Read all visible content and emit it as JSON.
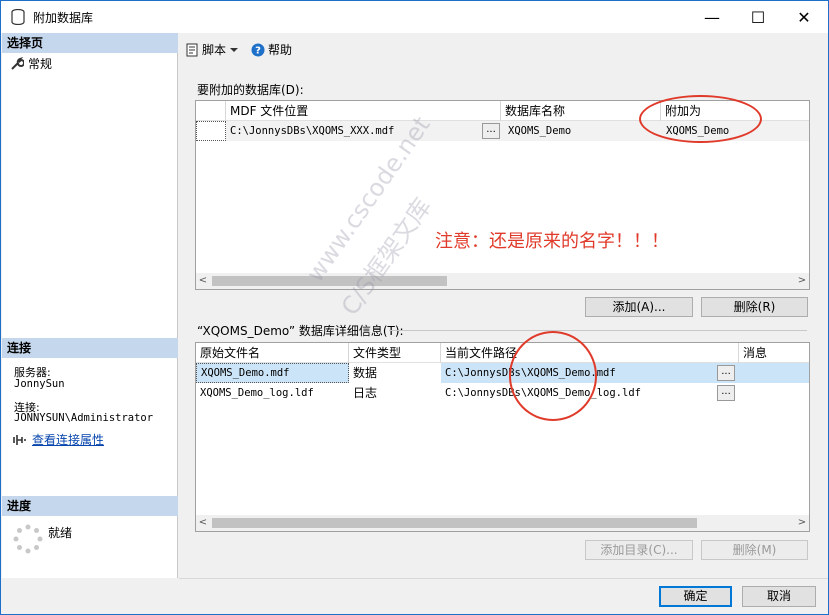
{
  "window": {
    "title": "附加数据库",
    "controls": {
      "minimize": "—",
      "maximize": "☐",
      "close": "✕"
    }
  },
  "left": {
    "select_page_header": "选择页",
    "pages": [
      {
        "label": "常规",
        "icon": "wrench-icon"
      }
    ],
    "connection_header": "连接",
    "server_label": "服务器:",
    "server_value": "JonnySun",
    "connection_label": "连接:",
    "connection_value": "JONNYSUN\\Administrator",
    "view_connection_link": "查看连接属性",
    "progress_header": "进度",
    "progress_status": "就绪"
  },
  "toolbar": {
    "script_label": "脚本",
    "help_label": "帮助"
  },
  "attach_section": {
    "label": "要附加的数据库(D):",
    "columns": [
      "MDF 文件位置",
      "数据库名称",
      "附加为"
    ],
    "rows": [
      {
        "mdf_path": "C:\\JonnysDBs\\XQOMS_XXX.mdf",
        "db_name": "XQOMS_Demo",
        "attach_as": "XQOMS_Demo"
      }
    ],
    "add_button": "添加(A)...",
    "remove_button": "删除(R)"
  },
  "annotation": {
    "note": "注意：还是原来的名字！！！"
  },
  "details_section": {
    "label": "“XQOMS_Demo” 数据库详细信息(T):",
    "columns": [
      "原始文件名",
      "文件类型",
      "当前文件路径",
      "消息"
    ],
    "rows": [
      {
        "file": "XQOMS_Demo.mdf",
        "type": "数据",
        "path": "C:\\JonnysDBs\\XQOMS_Demo.mdf",
        "message": ""
      },
      {
        "file": "XQOMS_Demo_log.ldf",
        "type": "日志",
        "path": "C:\\JonnysDBs\\XQOMS_Demo_log.ldf",
        "message": ""
      }
    ],
    "add_catalog_button": "添加目录(C)...",
    "remove_button": "删除(M)"
  },
  "footer": {
    "ok_button": "确定",
    "cancel_button": "取消"
  },
  "watermark": {
    "line1": "www.cscode.net",
    "line2": "C/S框架文库"
  },
  "ellipsis": "...",
  "colors": {
    "accent": "#0078d7",
    "selection": "#cce4f7",
    "annotation": "#e03a2a"
  }
}
